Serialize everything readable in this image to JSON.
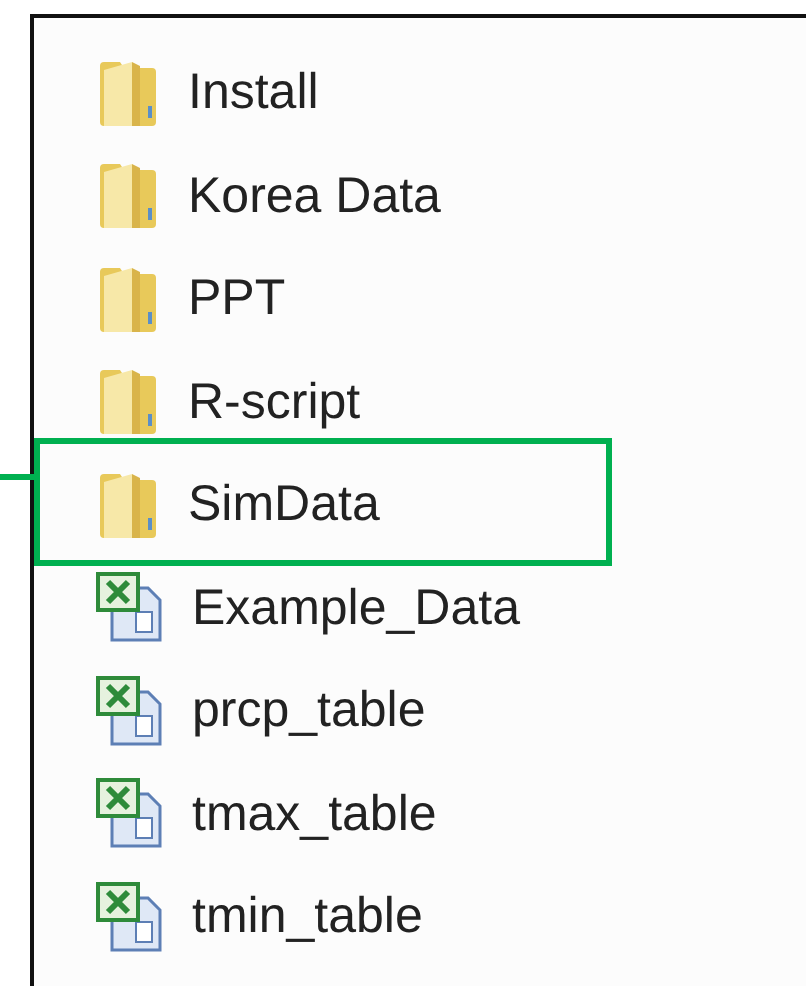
{
  "files": [
    {
      "name": "Install",
      "kind": "folder",
      "highlighted": false
    },
    {
      "name": "Korea Data",
      "kind": "folder",
      "highlighted": false
    },
    {
      "name": "PPT",
      "kind": "folder",
      "highlighted": false
    },
    {
      "name": "R-script",
      "kind": "folder",
      "highlighted": false
    },
    {
      "name": "SimData",
      "kind": "folder",
      "highlighted": true
    },
    {
      "name": "Example_Data",
      "kind": "spreadsheet",
      "highlighted": false
    },
    {
      "name": "prcp_table",
      "kind": "spreadsheet",
      "highlighted": false
    },
    {
      "name": "tmax_table",
      "kind": "spreadsheet",
      "highlighted": false
    },
    {
      "name": "tmin_table",
      "kind": "spreadsheet",
      "highlighted": false
    }
  ]
}
